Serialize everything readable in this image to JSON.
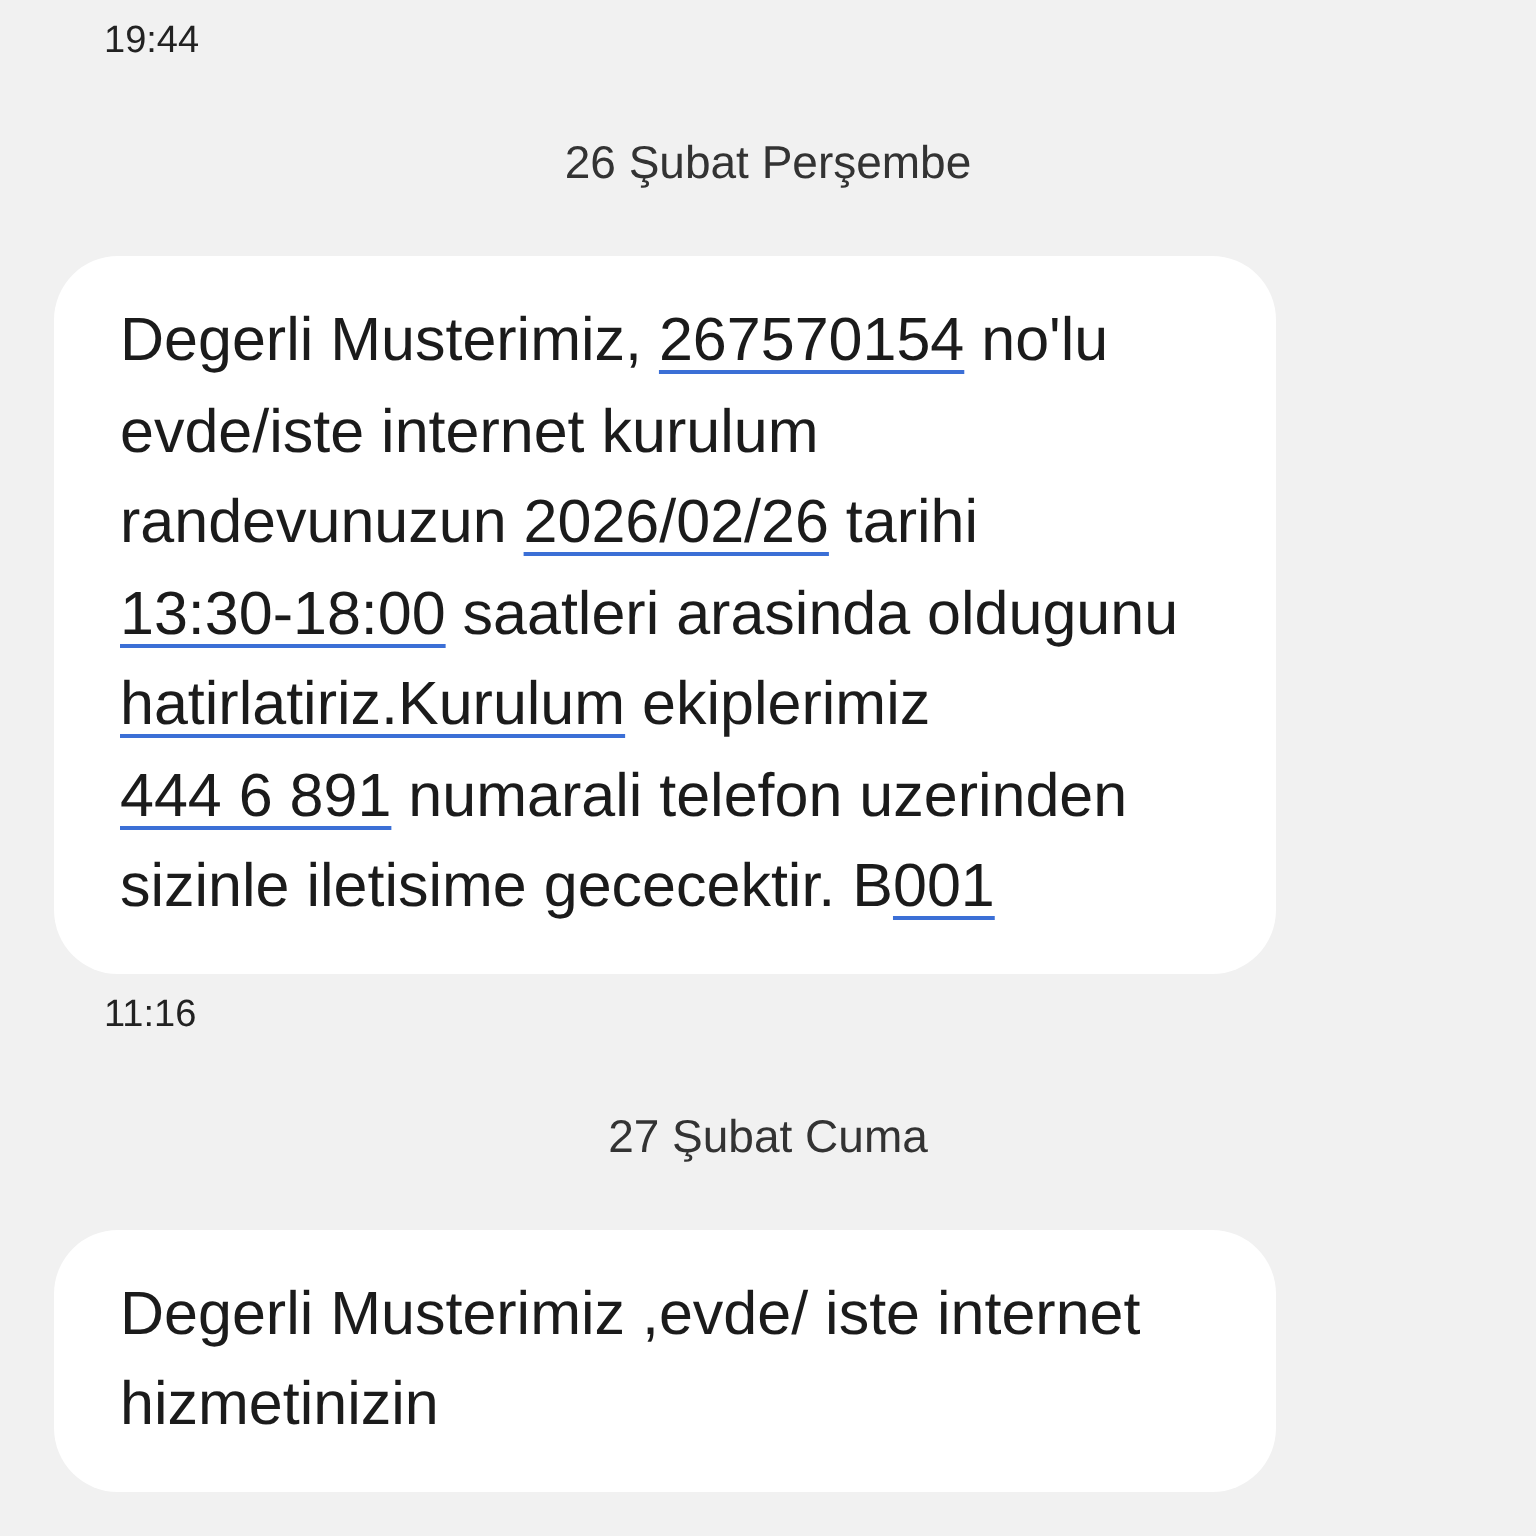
{
  "messages": [
    {
      "time": "19:44",
      "date": "26 Şubat Perşembe",
      "segments": [
        {
          "kind": "text",
          "text": "Degerli Musterimiz, "
        },
        {
          "kind": "link",
          "text": "267570154"
        },
        {
          "kind": "text",
          "text": " no'lu evde/iste internet kurulum randevunuzun "
        },
        {
          "kind": "link",
          "text": "2026/02/26"
        },
        {
          "kind": "text",
          "text": " tarihi "
        },
        {
          "kind": "link",
          "text": "13:30-18:00"
        },
        {
          "kind": "text",
          "text": " saatleri arasinda oldugunu "
        },
        {
          "kind": "link",
          "text": "hatirlatiriz.Kurulum"
        },
        {
          "kind": "text",
          "text": " ekiplerimiz "
        },
        {
          "kind": "link",
          "text": "444 6 891"
        },
        {
          "kind": "text",
          "text": " numarali telefon uzerinden sizinle iletisime gececektir. B"
        },
        {
          "kind": "link",
          "text": "001"
        }
      ]
    },
    {
      "time": "11:16",
      "date": "27 Şubat Cuma",
      "segments": [
        {
          "kind": "text",
          "text": "Degerli Musterimiz ,evde/ iste internet hizmetinizin"
        }
      ]
    }
  ]
}
